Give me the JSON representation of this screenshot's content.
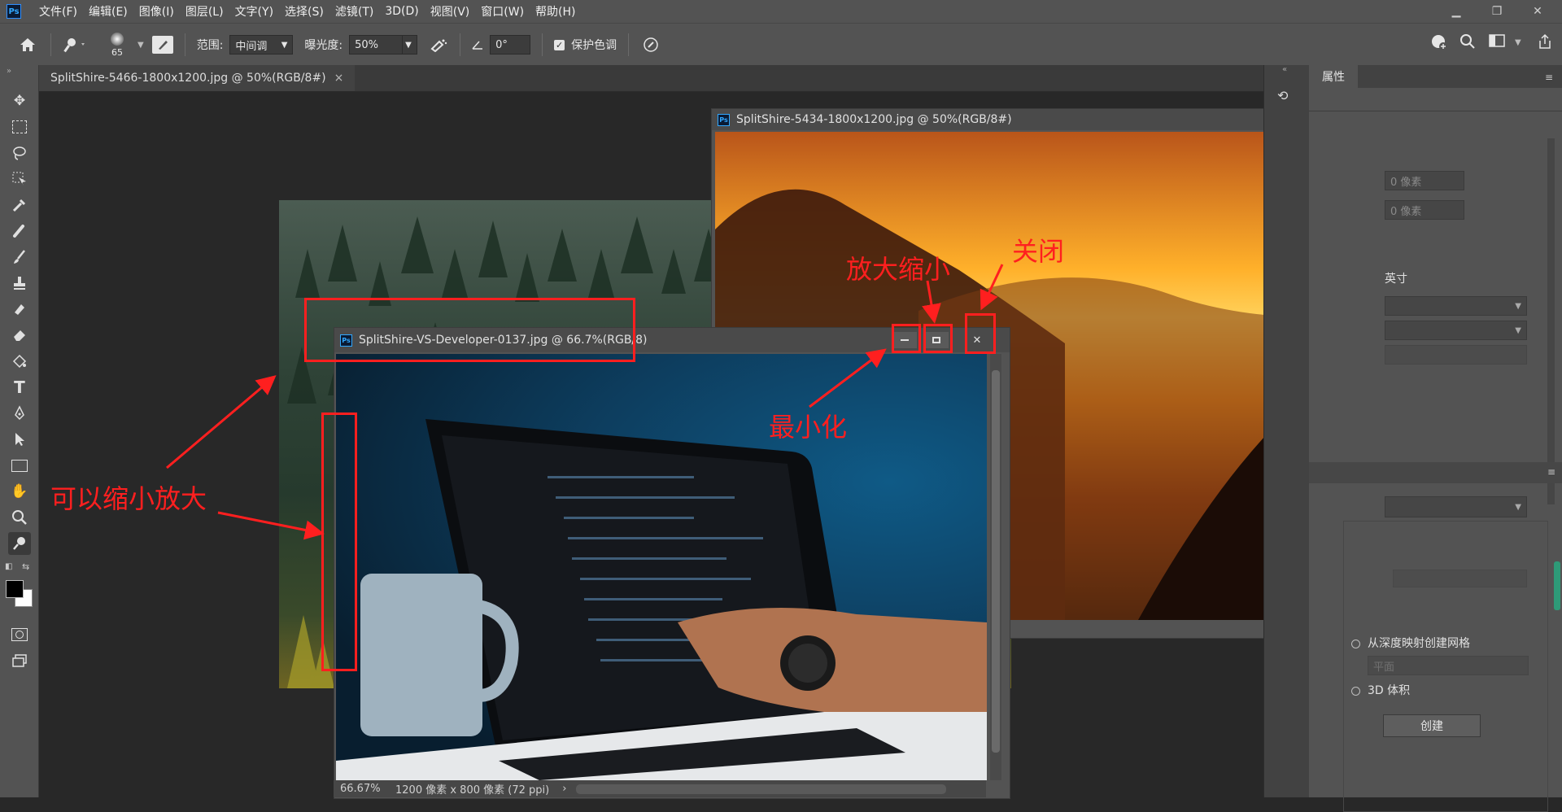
{
  "menubar": {
    "logo": "Ps",
    "items": [
      "文件(F)",
      "编辑(E)",
      "图像(I)",
      "图层(L)",
      "文字(Y)",
      "选择(S)",
      "滤镜(T)",
      "3D(D)",
      "视图(V)",
      "窗口(W)",
      "帮助(H)"
    ],
    "window_controls": {
      "minimize": "▁",
      "restore": "❐",
      "close": "✕"
    }
  },
  "options": {
    "brush_size": "65",
    "range_label": "范围:",
    "range_value": "中间调",
    "exposure_label": "曝光度:",
    "exposure_value": "50%",
    "angle_value": "0°",
    "protect_label": "保护色调",
    "protect_checked": true
  },
  "tab": {
    "title": "SplitShire-5466-1800x1200.jpg @ 50%(RGB/8#)",
    "close": "×"
  },
  "windows": {
    "sunset": {
      "title": "SplitShire-5434-1800x1200.jpg @ 50%(RGB/8#)"
    },
    "laptop": {
      "title": "SplitShire-VS-Developer-0137.jpg @ 66.7%(RGB/8)"
    }
  },
  "statusbar": {
    "zoom": "66.67%",
    "info": "1200 像素 x 800 像素 (72 ppi)",
    "arrow": "›"
  },
  "rightpanel": {
    "tab_label": "属性",
    "field1": "0 像素",
    "field2": "0 像素",
    "unit_label": "英寸",
    "radio1_label": "从深度映射创建网格",
    "dropdown_value": "平面",
    "radio2_label": "3D 体积",
    "create_button": "创建"
  },
  "annotations": {
    "zoom_text": "可以缩小放大",
    "maximize_text": "放大缩小",
    "close_text": "关闭",
    "minimize_text": "最小化"
  },
  "colors": {
    "annotation": "#ff1f1f",
    "ps_blue": "#31a8ff",
    "panel": "#535353"
  }
}
